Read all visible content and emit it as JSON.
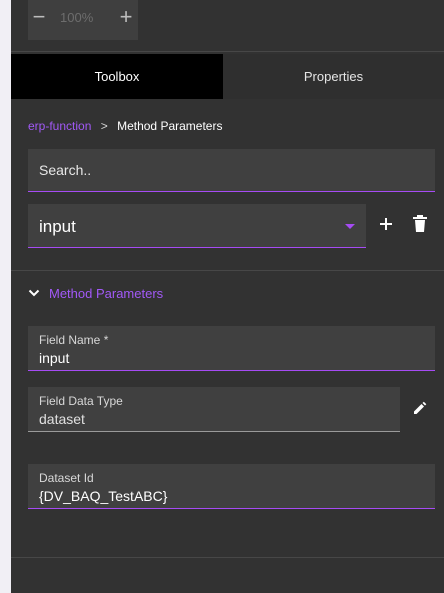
{
  "zoom": {
    "minus": "−",
    "level": "100%",
    "plus": "+"
  },
  "tabs": {
    "toolbox": "Toolbox",
    "properties": "Properties"
  },
  "breadcrumb": {
    "parent": "erp-function",
    "separator": ">",
    "current": "Method Parameters"
  },
  "search": {
    "placeholder": "Search.."
  },
  "selector": {
    "value": "input"
  },
  "section": {
    "title": "Method Parameters"
  },
  "fields": {
    "name": {
      "label": "Field Name *",
      "value": "input"
    },
    "data_type": {
      "label": "Field Data Type",
      "value": "dataset"
    },
    "dataset_id": {
      "label": "Dataset Id",
      "value": "{DV_BAQ_TestABC}"
    }
  },
  "colors": {
    "accent": "#a259f7",
    "panel_bg": "#323232",
    "field_bg": "#404040",
    "active_tab_bg": "#000000"
  },
  "icons": [
    "add-icon",
    "delete-icon",
    "chevron-down-icon",
    "edit-pencil-icon",
    "dropdown-arrow-icon"
  ]
}
